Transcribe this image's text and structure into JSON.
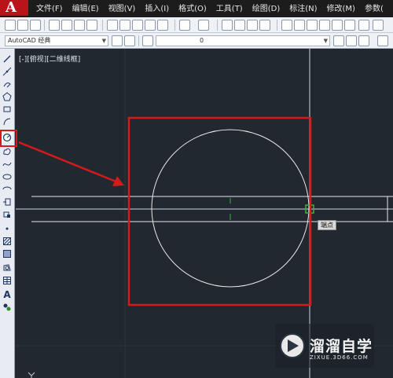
{
  "app": {
    "logo_letter": "A"
  },
  "menu": [
    {
      "label": "文件(F)"
    },
    {
      "label": "编辑(E)"
    },
    {
      "label": "视图(V)"
    },
    {
      "label": "插入(I)"
    },
    {
      "label": "格式(O)"
    },
    {
      "label": "工具(T)"
    },
    {
      "label": "绘图(D)"
    },
    {
      "label": "标注(N)"
    },
    {
      "label": "修改(M)"
    },
    {
      "label": "参数("
    }
  ],
  "toolbar": {
    "workspace_select": "AutoCAD 经典",
    "layer_select": "0"
  },
  "left_toolbar": {
    "tools": [
      "line-icon",
      "construction-line-icon",
      "polyline-icon",
      "polygon-icon",
      "rectangle-icon",
      "arc-icon",
      "circle-icon",
      "revision-cloud-icon",
      "spline-icon",
      "ellipse-icon",
      "ellipse-arc-icon",
      "insert-block-icon",
      "make-block-icon",
      "point-icon",
      "hatch-icon",
      "gradient-icon",
      "region-icon",
      "table-icon",
      "multiline-text-icon",
      "add-selected-icon"
    ],
    "active_tool": "circle-icon",
    "text_tool_glyph": "A"
  },
  "viewport": {
    "label": "[-][俯视][二维线框]",
    "snap_tooltip": "端点"
  },
  "colors": {
    "canvas_bg": "#212830",
    "highlight_red": "#d41a1a",
    "snap_green": "#3cb43c",
    "geometry_white": "#e8e8e8"
  },
  "watermark": {
    "title": "溜溜自学",
    "url": "ZIXUE.3D66.COM"
  }
}
